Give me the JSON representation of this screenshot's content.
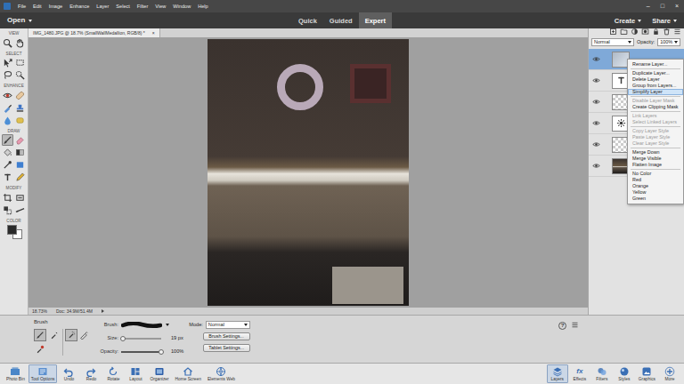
{
  "menu_bar": {
    "items": [
      "File",
      "Edit",
      "Image",
      "Enhance",
      "Layer",
      "Select",
      "Filter",
      "View",
      "Window",
      "Help"
    ],
    "window_controls": [
      "–",
      "□",
      "×"
    ]
  },
  "header": {
    "open": "Open",
    "modes": [
      {
        "label": "Quick",
        "selected": false
      },
      {
        "label": "Guided",
        "selected": false
      },
      {
        "label": "Expert",
        "selected": true
      }
    ],
    "create": "Create",
    "share": "Share"
  },
  "document_tab": {
    "title": "IMG_1480.JPG @ 18.7% (SmallWallMedallion, RGB/8) *",
    "close": "×"
  },
  "toolbox": {
    "sections": [
      {
        "label": "VIEW",
        "tools": [
          {
            "kind": "zoom",
            "selected": false
          },
          {
            "kind": "hand",
            "selected": false
          }
        ]
      },
      {
        "label": "SELECT",
        "tools": [
          {
            "kind": "move",
            "selected": false
          },
          {
            "kind": "marquee",
            "selected": false
          },
          {
            "kind": "lasso",
            "selected": false
          },
          {
            "kind": "quick-select",
            "selected": false
          }
        ]
      },
      {
        "label": "ENHANCE",
        "tools": [
          {
            "kind": "red-eye",
            "selected": false
          },
          {
            "kind": "spot-heal",
            "selected": false
          },
          {
            "kind": "smart-brush",
            "selected": false
          },
          {
            "kind": "clone-stamp",
            "selected": false
          },
          {
            "kind": "blur",
            "selected": false
          },
          {
            "kind": "sponge",
            "selected": false
          }
        ]
      },
      {
        "label": "DRAW",
        "tools": [
          {
            "kind": "brush",
            "selected": true
          },
          {
            "kind": "eraser",
            "selected": false
          },
          {
            "kind": "bucket",
            "selected": false
          },
          {
            "kind": "gradient",
            "selected": false
          },
          {
            "kind": "eyedropper",
            "selected": false
          },
          {
            "kind": "shape",
            "selected": false
          },
          {
            "kind": "text",
            "selected": false
          },
          {
            "kind": "pencil",
            "selected": false
          }
        ]
      },
      {
        "label": "MODIFY",
        "tools": [
          {
            "kind": "crop",
            "selected": false
          },
          {
            "kind": "recompose",
            "selected": false
          },
          {
            "kind": "content-move",
            "selected": false
          },
          {
            "kind": "straighten",
            "selected": false
          }
        ]
      }
    ],
    "color": {
      "label": "COLOR",
      "foreground": "#2a2a2a",
      "background": "#ffffff"
    }
  },
  "status_bar": {
    "zoom": "18.73%",
    "doc": "Doc: 34.9M/51.4M"
  },
  "layers_panel": {
    "blend_mode": "Normal",
    "opacity_label": "Opacity:",
    "opacity": "100%",
    "layers": [
      {
        "kind": "image",
        "selected": true,
        "visible": true
      },
      {
        "kind": "text",
        "selected": false,
        "visible": true
      },
      {
        "kind": "transparent",
        "selected": false,
        "visible": true
      },
      {
        "kind": "adjustment",
        "selected": false,
        "visible": true
      },
      {
        "kind": "transparent",
        "selected": false,
        "visible": true
      },
      {
        "kind": "photo",
        "selected": false,
        "visible": true
      }
    ]
  },
  "context_menu": {
    "groups": [
      [
        {
          "label": "Rename Layer...",
          "disabled": false,
          "selected": false
        }
      ],
      [
        {
          "label": "Duplicate Layer...",
          "disabled": false,
          "selected": false
        },
        {
          "label": "Delete Layer",
          "disabled": false,
          "selected": false
        },
        {
          "label": "Group from Layers...",
          "disabled": false,
          "selected": false
        },
        {
          "label": "Simplify Layer",
          "disabled": false,
          "selected": true
        }
      ],
      [
        {
          "label": "Disable Layer Mask",
          "disabled": true,
          "selected": false
        },
        {
          "label": "Create Clipping Mask",
          "disabled": false,
          "selected": false
        }
      ],
      [
        {
          "label": "Link Layers",
          "disabled": true,
          "selected": false
        },
        {
          "label": "Select Linked Layers",
          "disabled": true,
          "selected": false
        }
      ],
      [
        {
          "label": "Copy Layer Style",
          "disabled": true,
          "selected": false
        },
        {
          "label": "Paste Layer Style",
          "disabled": true,
          "selected": false
        },
        {
          "label": "Clear Layer Style",
          "disabled": true,
          "selected": false
        }
      ],
      [
        {
          "label": "Merge Down",
          "disabled": false,
          "selected": false
        },
        {
          "label": "Merge Visible",
          "disabled": false,
          "selected": false
        },
        {
          "label": "Flatten Image",
          "disabled": false,
          "selected": false
        }
      ],
      [
        {
          "label": "No Color",
          "disabled": false,
          "selected": false
        },
        {
          "label": "Red",
          "disabled": false,
          "selected": false
        },
        {
          "label": "Orange",
          "disabled": false,
          "selected": false
        },
        {
          "label": "Yellow",
          "disabled": false,
          "selected": false
        },
        {
          "label": "Green",
          "disabled": false,
          "selected": false
        }
      ]
    ]
  },
  "tool_options": {
    "title": "Brush",
    "variants": [
      {
        "kind": "brush",
        "selected": true
      },
      {
        "kind": "impressionist",
        "selected": false
      },
      {
        "kind": "color-replace",
        "selected": false
      }
    ],
    "toggles": [
      {
        "kind": "airbrush",
        "selected": true
      },
      {
        "kind": "pressure",
        "selected": false
      }
    ],
    "brush_label": "Brush:",
    "size": {
      "label": "Size:",
      "value": "19 px",
      "level": 0.05
    },
    "opacity": {
      "label": "Opacity:",
      "value": "100%",
      "level": 1
    },
    "mode_label": "Mode:",
    "mode": "Normal",
    "buttons": [
      "Brush Settings...",
      "Tablet Settings..."
    ],
    "help": "?"
  },
  "taskbar": {
    "left": [
      {
        "label": "Photo Bin",
        "kind": "photo-bin",
        "selected": false
      },
      {
        "label": "Tool Options",
        "kind": "tool-options",
        "selected": true
      },
      {
        "label": "Undo",
        "kind": "undo",
        "selected": false
      },
      {
        "label": "Redo",
        "kind": "redo",
        "selected": false
      },
      {
        "label": "Rotate",
        "kind": "rotate",
        "selected": false
      },
      {
        "label": "Layout",
        "kind": "layout",
        "selected": false
      },
      {
        "label": "Organizer",
        "kind": "organizer",
        "selected": false
      },
      {
        "label": "Home Screen",
        "kind": "home",
        "selected": false
      },
      {
        "label": "Elements Web",
        "kind": "web",
        "selected": false
      }
    ],
    "right": [
      {
        "label": "Layers",
        "kind": "layers",
        "selected": true
      },
      {
        "label": "Effects",
        "kind": "effects",
        "glyph": "fx",
        "selected": false
      },
      {
        "label": "Filters",
        "kind": "filters",
        "selected": false
      },
      {
        "label": "Styles",
        "kind": "styles",
        "selected": false
      },
      {
        "label": "Graphics",
        "kind": "graphics",
        "selected": false
      },
      {
        "label": "More",
        "kind": "more",
        "selected": false
      }
    ]
  }
}
